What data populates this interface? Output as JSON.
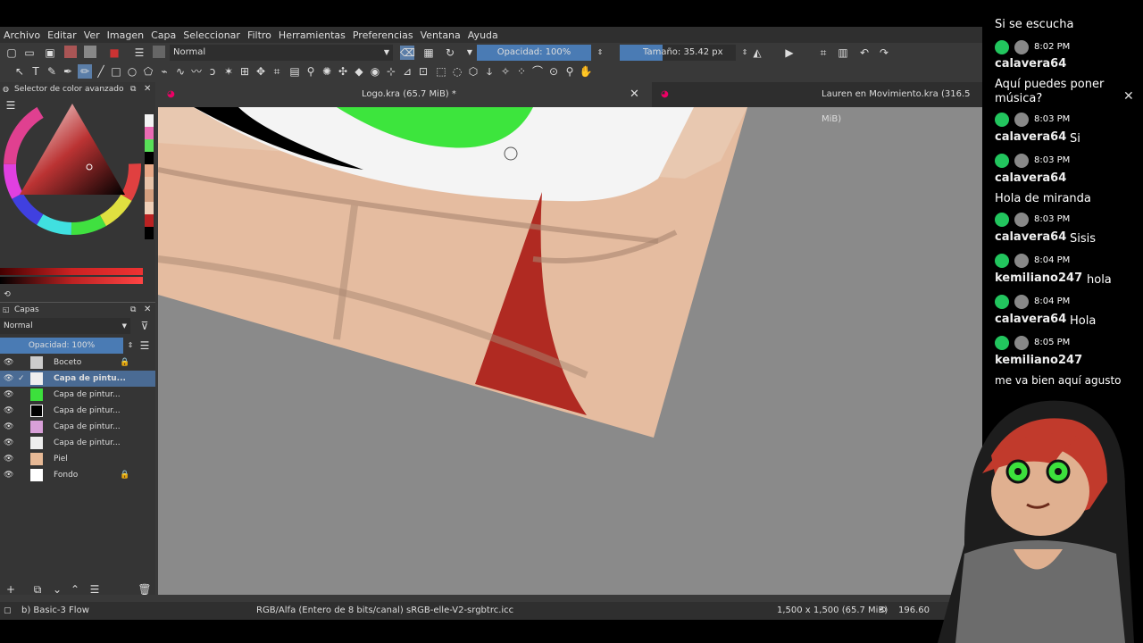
{
  "menu": [
    "Archivo",
    "Editar",
    "Ver",
    "Imagen",
    "Capa",
    "Seleccionar",
    "Filtro",
    "Herramientas",
    "Preferencias",
    "Ventana",
    "Ayuda"
  ],
  "toolbar": {
    "blend_mode": "Normal",
    "opacity": "Opacidad: 100%",
    "size": "Tamaño: 35.42 px"
  },
  "color_panel": {
    "title": "Selector de color avanzado"
  },
  "layers_panel": {
    "title": "Capas",
    "blend_mode": "Normal",
    "opacity": "Opacidad:  100%",
    "layers": [
      {
        "name": "Boceto"
      },
      {
        "name": "Capa de pintu..."
      },
      {
        "name": "Capa de pintur..."
      },
      {
        "name": "Capa de pintur..."
      },
      {
        "name": "Capa de pintur..."
      },
      {
        "name": "Capa de pintur..."
      },
      {
        "name": "Piel"
      },
      {
        "name": "Fondo"
      }
    ]
  },
  "tabs": [
    {
      "label": "Logo.kra (65.7 MiB) *"
    },
    {
      "label": "Lauren en Movimiento.kra (316.5 MiB)"
    }
  ],
  "status": {
    "brush": "b) Basic-3 Flow",
    "color_space": "RGB/Alfa (Entero de 8 bits/canal)  sRGB-elle-V2-srgbtrc.icc",
    "dimensions": "1,500 x 1,500 (65.7 MiB)",
    "zoom": "196.60"
  },
  "chat": {
    "messages": [
      {
        "user": "",
        "time": "",
        "text": "Si se escucha"
      },
      {
        "user": "calavera64",
        "time": "8:02 PM",
        "text": "Aquí puedes poner"
      },
      {
        "user": "",
        "time": "",
        "text": "música?"
      },
      {
        "user": "calavera64",
        "time": "8:03 PM",
        "text": "Si"
      },
      {
        "user": "calavera64",
        "time": "8:03 PM",
        "text": "Hola de miranda"
      },
      {
        "user": "calavera64",
        "time": "8:03 PM",
        "text": "Sisis"
      },
      {
        "user": "kemiliano247",
        "time": "8:04 PM",
        "text": "hola"
      },
      {
        "user": "calavera64",
        "time": "8:04 PM",
        "text": "Hola"
      },
      {
        "user": "kemiliano247",
        "time": "8:05 PM",
        "text": "me va bien aquí agusto"
      }
    ]
  },
  "colors": {
    "accent": "#4a7bb4",
    "green_badge": "#22c55e"
  }
}
